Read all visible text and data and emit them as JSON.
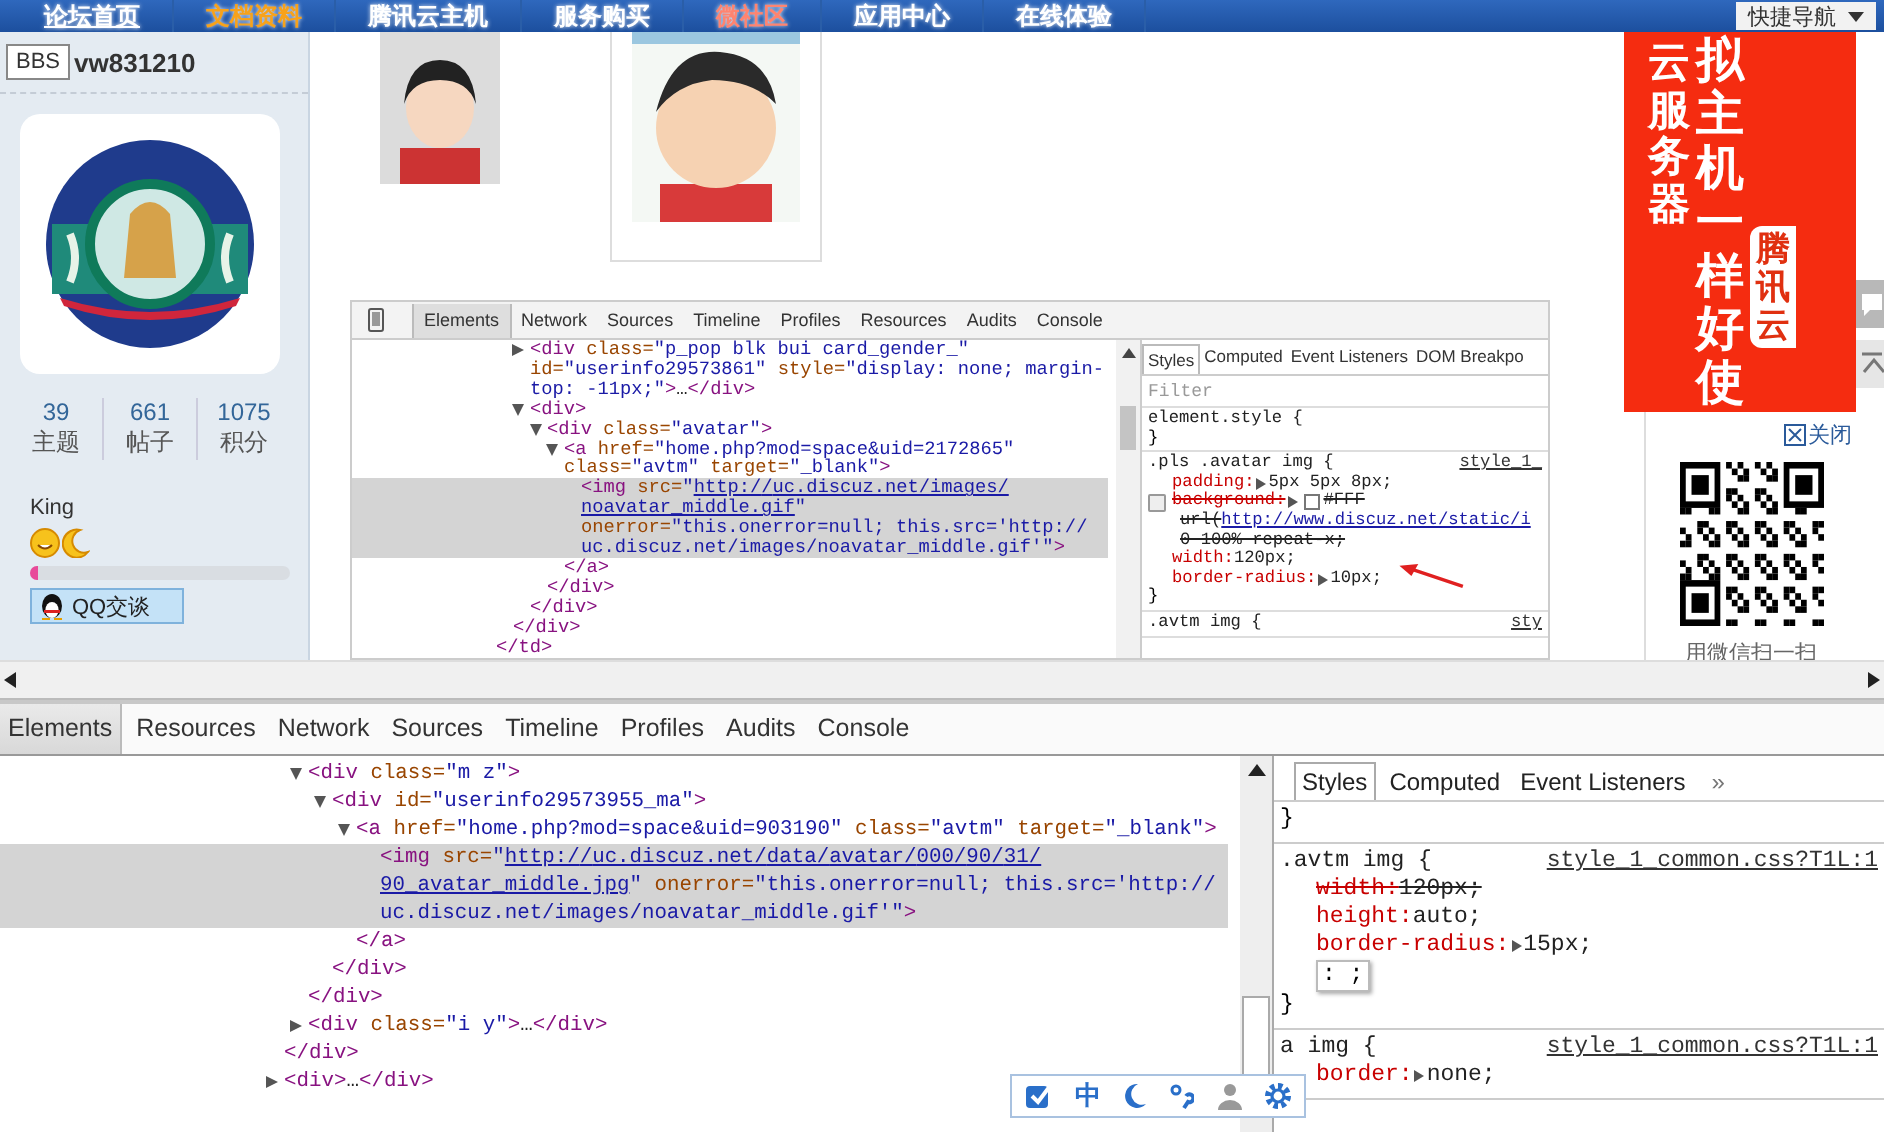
{
  "nav": {
    "items": [
      {
        "label": "论坛首页",
        "selected": true,
        "color": "#ffffff"
      },
      {
        "label": "文档资料",
        "selected": false,
        "color": "#f7a21b"
      },
      {
        "label": "腾讯云主机",
        "selected": false,
        "color": "#ffffff"
      },
      {
        "label": "服务购买",
        "selected": false,
        "color": "#ffffff"
      },
      {
        "label": "微社区",
        "selected": false,
        "color": "#ff8470"
      },
      {
        "label": "应用中心",
        "selected": false,
        "color": "#ffffff"
      },
      {
        "label": "在线体验",
        "selected": false,
        "color": "#ffffff"
      }
    ],
    "quick_nav": "快捷导航"
  },
  "profile": {
    "tooltip": "BBS",
    "username": "vw831210",
    "stats": [
      {
        "value": "39",
        "label": "主题"
      },
      {
        "value": "661",
        "label": "帖子"
      },
      {
        "value": "1075",
        "label": "积分"
      }
    ],
    "rank": "King",
    "level": 0.03,
    "qq_button": "QQ交谈"
  },
  "inner_devtools": {
    "tabs": [
      {
        "label": "Elements",
        "selected": true
      },
      {
        "label": "Network",
        "selected": false
      },
      {
        "label": "Sources",
        "selected": false
      },
      {
        "label": "Timeline",
        "selected": false
      },
      {
        "label": "Profiles",
        "selected": false
      },
      {
        "label": "Resources",
        "selected": false
      },
      {
        "label": "Audits",
        "selected": false
      },
      {
        "label": "Console",
        "selected": false
      }
    ],
    "tree": [
      {
        "close": "</td>",
        "children": [
          {
            "close": "</div>",
            "children": [
              {
                "text": "<div class=\"p_pop blk bui card_gender_\" id=\"userinfo29573861\" style=\"display: none; margin-top: -11px;\">…</div>",
                "expanded": false,
                "selected": false
              },
              {
                "text": "<div>",
                "expanded": true,
                "selected": false,
                "close": "</div>",
                "children": [
                  {
                    "text": "<div class=\"avatar\">",
                    "expanded": true,
                    "selected": false,
                    "close": "</div>",
                    "children": [
                      {
                        "text": "<a href=\"home.php?mod=space&uid=2172865\" class=\"avtm\" target=\"_blank\">",
                        "expanded": true,
                        "selected": false,
                        "close": "</a>",
                        "children": [
                          {
                            "before": "<img src=\"",
                            "link": "http://uc.discuz.net/images/noavatar_middle.gif",
                            "after": "\" onerror=\"this.onerror=null; this.src='http://uc.discuz.net/images/noavatar_middle.gif'\">",
                            "selected": true
                          }
                        ]
                      }
                    ]
                  }
                ]
              }
            ]
          }
        ]
      }
    ],
    "styles": {
      "tabs": [
        {
          "label": "Styles",
          "selected": true
        },
        {
          "label": "Computed",
          "selected": false
        },
        {
          "label": "Event Listeners",
          "selected": false
        },
        {
          "label": "DOM Breakpo",
          "selected": false
        }
      ],
      "filter_placeholder": "Filter",
      "rules": [
        {
          "selector": "element.style {",
          "close": "}"
        },
        {
          "selector": ".pls .avatar img {",
          "source": "style_1_",
          "props": [
            {
              "kind": "prop",
              "name": "padding:",
              "value": "5px 5px 8px;",
              "expandable": true,
              "struck": false
            },
            {
              "kind": "prop",
              "name": "background:",
              "value": "#FFF",
              "expandable": true,
              "swatch": true,
              "struck": true,
              "checked": false,
              "more": [
                {
                  "text": "url(",
                  "link": "http://www.discuz.net/static/i"
                },
                {
                  "text": "0 100% repeat-x;"
                }
              ]
            },
            {
              "kind": "prop",
              "name": "width:",
              "value": "120px;",
              "expandable": false,
              "struck": false
            },
            {
              "kind": "prop",
              "name": "border-radius:",
              "value": "10px;",
              "expandable": true,
              "struck": false,
              "annotated": true
            }
          ],
          "close": "}"
        },
        {
          "selector": ".avtm img {",
          "source": "sty"
        }
      ]
    }
  },
  "ad": {
    "columns": [
      "云服务器",
      "拟主机一样好使",
      "腾讯云"
    ],
    "close": "关闭",
    "qr_caption": "用微信扫一扫"
  },
  "devtools": {
    "tabs": [
      {
        "label": "Elements",
        "selected": true
      },
      {
        "label": "Resources",
        "selected": false
      },
      {
        "label": "Network",
        "selected": false
      },
      {
        "label": "Sources",
        "selected": false
      },
      {
        "label": "Timeline",
        "selected": false
      },
      {
        "label": "Profiles",
        "selected": false
      },
      {
        "label": "Audits",
        "selected": false
      },
      {
        "label": "Console",
        "selected": false
      }
    ],
    "tree": [
      {
        "close": "</div>",
        "children": [
          {
            "text": "<div class=\"m z\">",
            "expanded": true,
            "selected": false,
            "close": "</div>",
            "children": [
              {
                "text": "<div id=\"userinfo29573955_ma\">",
                "expanded": true,
                "selected": false,
                "close": "</div>",
                "children": [
                  {
                    "text": "<a href=\"home.php?mod=space&uid=903190\" class=\"avtm\" target=\"_blank\">",
                    "expanded": true,
                    "selected": false,
                    "close": "</a>",
                    "children": [
                      {
                        "before": "<img src=\"",
                        "link": "http://uc.discuz.net/data/avatar/000/90/31/90_avatar_middle.jpg",
                        "after": "\" onerror=\"this.onerror=null; this.src='http://uc.discuz.net/images/noavatar_middle.gif'\">",
                        "selected": true
                      }
                    ]
                  }
                ]
              }
            ]
          },
          {
            "text": "<div class=\"i y\">…</div>",
            "expanded": false,
            "selected": false
          }
        ]
      },
      {
        "text": "<div>…</div>",
        "expanded": false,
        "selected": false
      }
    ],
    "styles": {
      "tabs": [
        {
          "label": "Styles",
          "selected": true
        },
        {
          "label": "Computed",
          "selected": false
        },
        {
          "label": "Event Listeners",
          "selected": false
        }
      ],
      "more": "»",
      "rules": [
        {
          "close": "}"
        },
        {
          "selector": ".avtm img {",
          "source": "style_1_common.css?T1L:1",
          "props": [
            {
              "kind": "prop",
              "name": "width:",
              "value": "120px;",
              "expandable": false,
              "struck": true
            },
            {
              "kind": "prop",
              "name": "height:",
              "value": "auto;",
              "expandable": false,
              "struck": false
            },
            {
              "kind": "prop",
              "name": "border-radius:",
              "value": "15px;",
              "expandable": true,
              "struck": false
            },
            {
              "kind": "edit",
              "text": ": ;"
            }
          ],
          "close": "}"
        },
        {
          "selector": "a img {",
          "source": "style_1_common.css?T1L:1",
          "props": [
            {
              "kind": "prop",
              "name": "border:",
              "value": "none;",
              "expandable": true,
              "struck": false
            }
          ]
        }
      ]
    }
  },
  "ime": {
    "label": "中"
  }
}
